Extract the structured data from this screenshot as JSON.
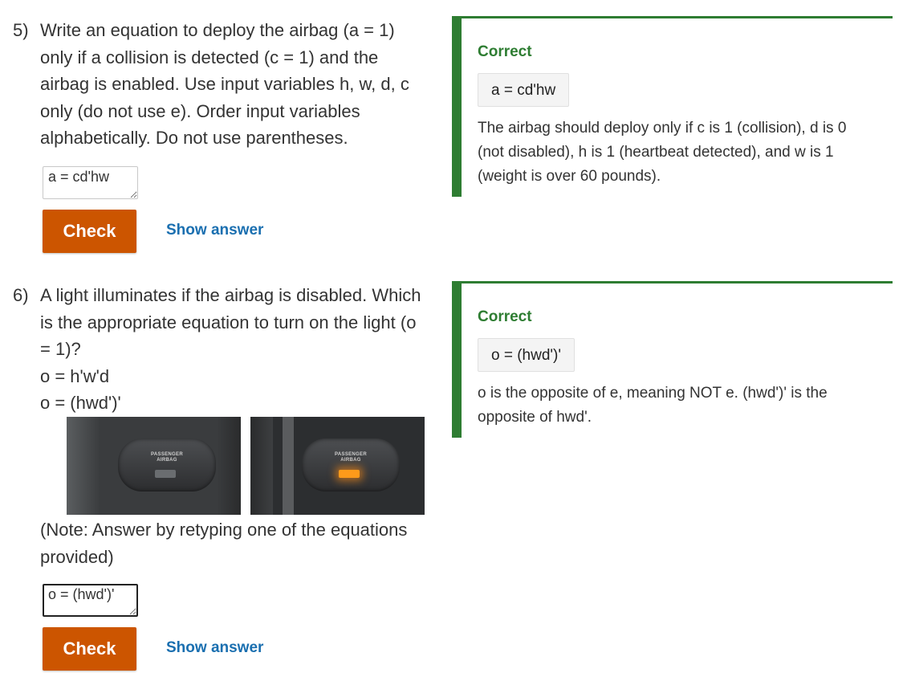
{
  "q5": {
    "number": "5)",
    "lines": [
      "Write an equation to deploy the airbag (a = 1)",
      "only if a collision is detected (c = 1) and the",
      "airbag is enabled. Use input variables h, w, d, c",
      "only (do not use e). Order input variables",
      "alphabetically. Do not use parentheses."
    ],
    "answer_value": "a = cd'hw",
    "check_label": "Check",
    "show_answer_label": "Show answer",
    "feedback": {
      "title": "Correct",
      "answer": "a = cd'hw",
      "explanation": [
        "The airbag should deploy only if c is 1 (collision), d is 0",
        "(not disabled), h is 1 (heartbeat detected), and w is 1",
        "(weight is over 60 pounds)."
      ]
    }
  },
  "q6": {
    "number": "6)",
    "lines": [
      "A light illuminates if the airbag is disabled. Which",
      "is the appropriate equation to turn on the light (o",
      "= 1)?",
      "o = h'w'd",
      "o = (hwd')'"
    ],
    "image_label_off": "PASSENGER AIRBAG",
    "image_label_on": "PASSENGER AIRBAG",
    "note_lines": [
      "(Note: Answer by retyping one of the equations",
      "provided)"
    ],
    "answer_value": "o = (hwd')'",
    "check_label": "Check",
    "show_answer_label": "Show answer",
    "feedback": {
      "title": "Correct",
      "answer": "o = (hwd')'",
      "explanation": [
        "o is the opposite of e, meaning NOT e. (hwd')' is the",
        "opposite of hwd'."
      ]
    }
  },
  "colors": {
    "accent_button": "#cc5500",
    "link": "#1a6fb0",
    "correct": "#2e7d32",
    "lamp_on": "#ff9a1a"
  }
}
